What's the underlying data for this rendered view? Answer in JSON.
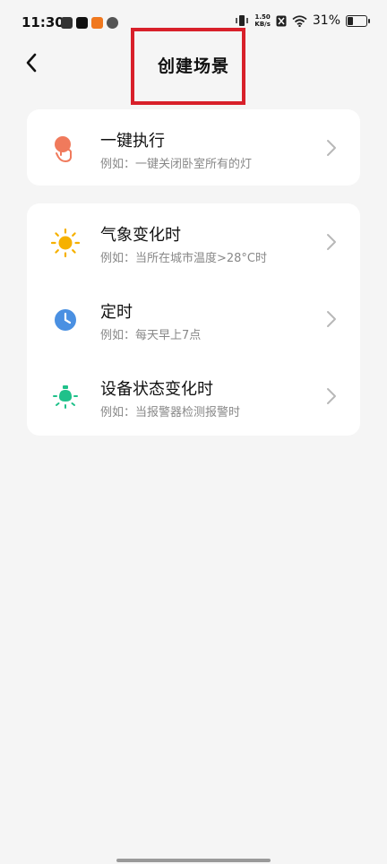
{
  "status_bar": {
    "time": "11:30",
    "speed_value": "1.50",
    "speed_unit": "KB/s",
    "battery": "31%",
    "app_icons": [
      "leaf-app-icon",
      "tiktok-icon",
      "taobao-icon",
      "fan-app-icon"
    ]
  },
  "header": {
    "title": "创建场景",
    "highlight_color": "#d8202a"
  },
  "card_manual": {
    "items": [
      {
        "title": "一键执行",
        "subtitle": "例如：一键关闭卧室所有的灯",
        "icon": "tap-hand-icon",
        "icon_color": "#f07a5c"
      }
    ]
  },
  "card_auto": {
    "items": [
      {
        "title": "气象变化时",
        "subtitle": "例如：当所在城市温度>28°C时",
        "icon": "sun-icon",
        "icon_color": "#f6b100"
      },
      {
        "title": "定时",
        "subtitle": "例如：每天早上7点",
        "icon": "clock-icon",
        "icon_color": "#4a90e2"
      },
      {
        "title": "设备状态变化时",
        "subtitle": "例如：当报警器检测报警时",
        "icon": "bulb-icon",
        "icon_color": "#1fc18a"
      }
    ]
  }
}
